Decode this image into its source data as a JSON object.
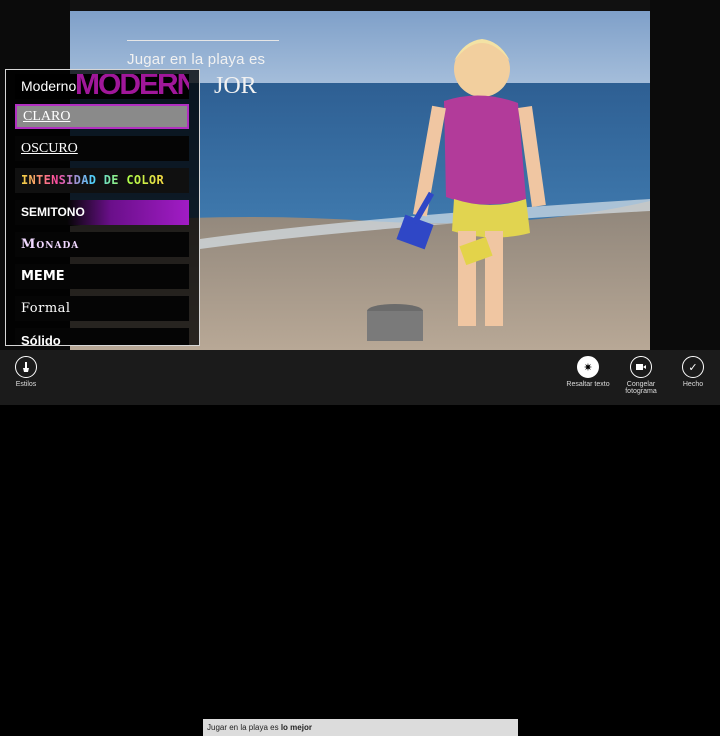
{
  "overlay": {
    "line1": "Jugar en la playa es",
    "line2": "JOR"
  },
  "styles_panel": {
    "items": [
      {
        "label": "Moderno",
        "selected": false
      },
      {
        "label": "CLARO",
        "selected": true
      },
      {
        "label": "OSCURO",
        "selected": false
      },
      {
        "label": "INTENSIDAD DE COLOR",
        "selected": false
      },
      {
        "label": "SEMITONO",
        "selected": false
      },
      {
        "label": "Monada",
        "selected": false
      },
      {
        "label": "MEME",
        "selected": false
      },
      {
        "label": "Formal",
        "selected": false
      },
      {
        "label": "Sólido",
        "selected": false
      }
    ]
  },
  "appbar": {
    "estilos_label": "Estilos",
    "resaltar_label": "Resaltar texto",
    "congelar_label_1": "Congelar",
    "congelar_label_2": "fotograma",
    "hecho_label": "Hecho"
  },
  "caption_input": {
    "prefix": "Jugar en la playa es ",
    "bold": "lo mejor"
  },
  "colors": {
    "accent": "#b12fc0",
    "appbar_bg": "#1b1b1b",
    "input_bg": "#dcdcdc"
  },
  "icons": {
    "estilos": "styles-icon",
    "resaltar": "highlight-text-icon",
    "congelar": "freeze-frame-icon",
    "hecho": "checkmark-icon"
  }
}
